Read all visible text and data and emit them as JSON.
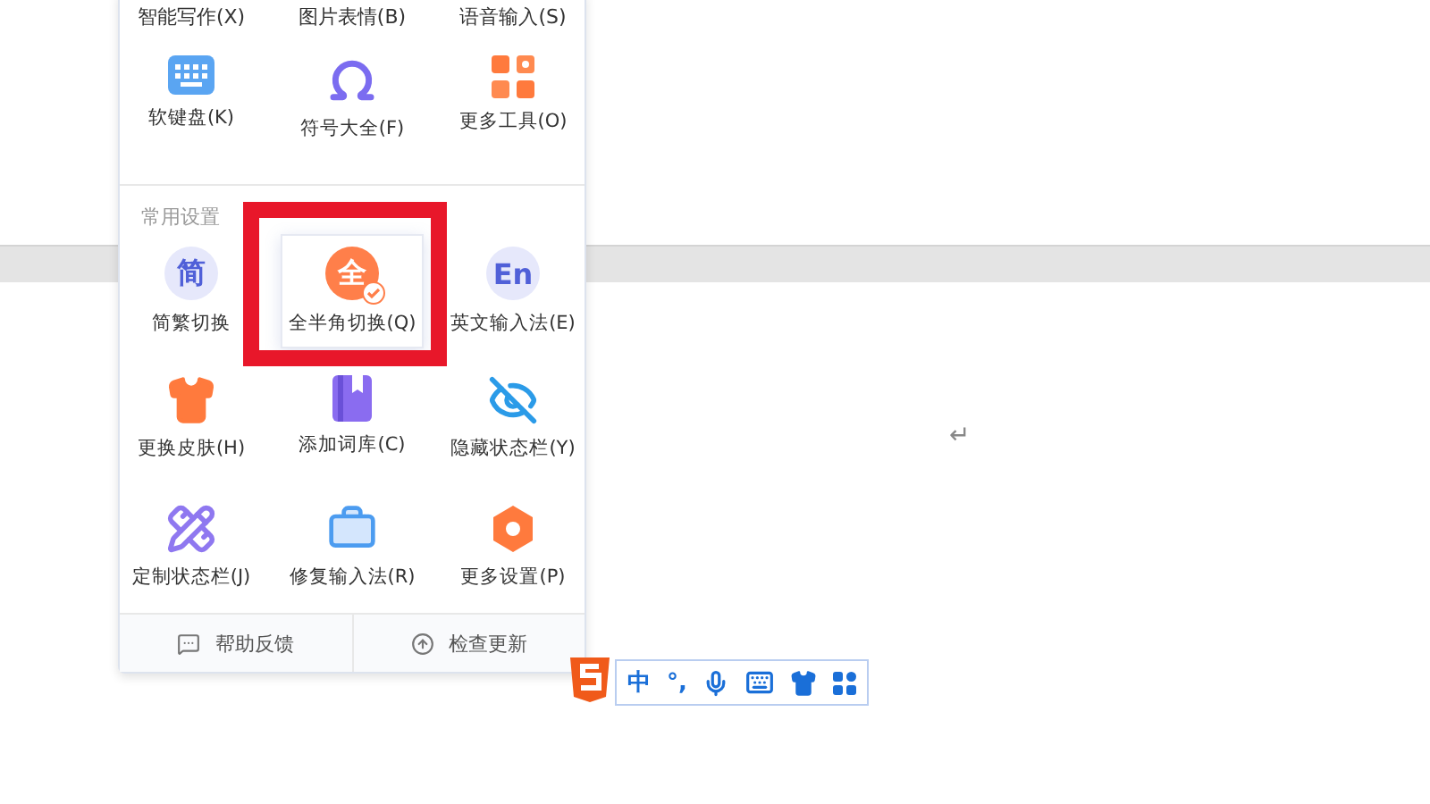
{
  "menu": {
    "tool_rows": [
      [
        {
          "label": "智能写作(X)",
          "kind": "none"
        },
        {
          "label": "图片表情(B)",
          "kind": "none"
        },
        {
          "label": "语音输入(S)",
          "kind": "none"
        }
      ],
      [
        {
          "label": "软键盘(K)",
          "kind": "keyboard"
        },
        {
          "label": "符号大全(F)",
          "kind": "omega"
        },
        {
          "label": "更多工具(O)",
          "kind": "apps"
        }
      ]
    ],
    "settings_heading": "常用设置",
    "settings": [
      {
        "label": "简繁切换",
        "kind": "glyph",
        "glyph": "简",
        "selected": false
      },
      {
        "label": "全半角切换(Q)",
        "kind": "badge",
        "glyph": "全",
        "selected": true
      },
      {
        "label": "英文输入法(E)",
        "kind": "glyph",
        "glyph": "En",
        "selected": false
      },
      {
        "label": "更换皮肤(H)",
        "kind": "shirt",
        "selected": false
      },
      {
        "label": "添加词库(C)",
        "kind": "book",
        "selected": false
      },
      {
        "label": "隐藏状态栏(Y)",
        "kind": "eye-off",
        "selected": false
      },
      {
        "label": "定制状态栏(J)",
        "kind": "ruler",
        "selected": false
      },
      {
        "label": "修复输入法(R)",
        "kind": "kit",
        "selected": false
      },
      {
        "label": "更多设置(P)",
        "kind": "hexagon",
        "selected": false
      }
    ],
    "footer": [
      {
        "label": "帮助反馈",
        "kind": "chat"
      },
      {
        "label": "检查更新",
        "kind": "up"
      }
    ]
  },
  "status_bar": {
    "items": [
      {
        "kind": "text",
        "text": "中"
      },
      {
        "kind": "text",
        "text": "°,"
      },
      {
        "kind": "mic"
      },
      {
        "kind": "keyboard"
      },
      {
        "kind": "shirt"
      },
      {
        "kind": "grid"
      }
    ]
  },
  "document": {
    "return_mark": "↵"
  }
}
